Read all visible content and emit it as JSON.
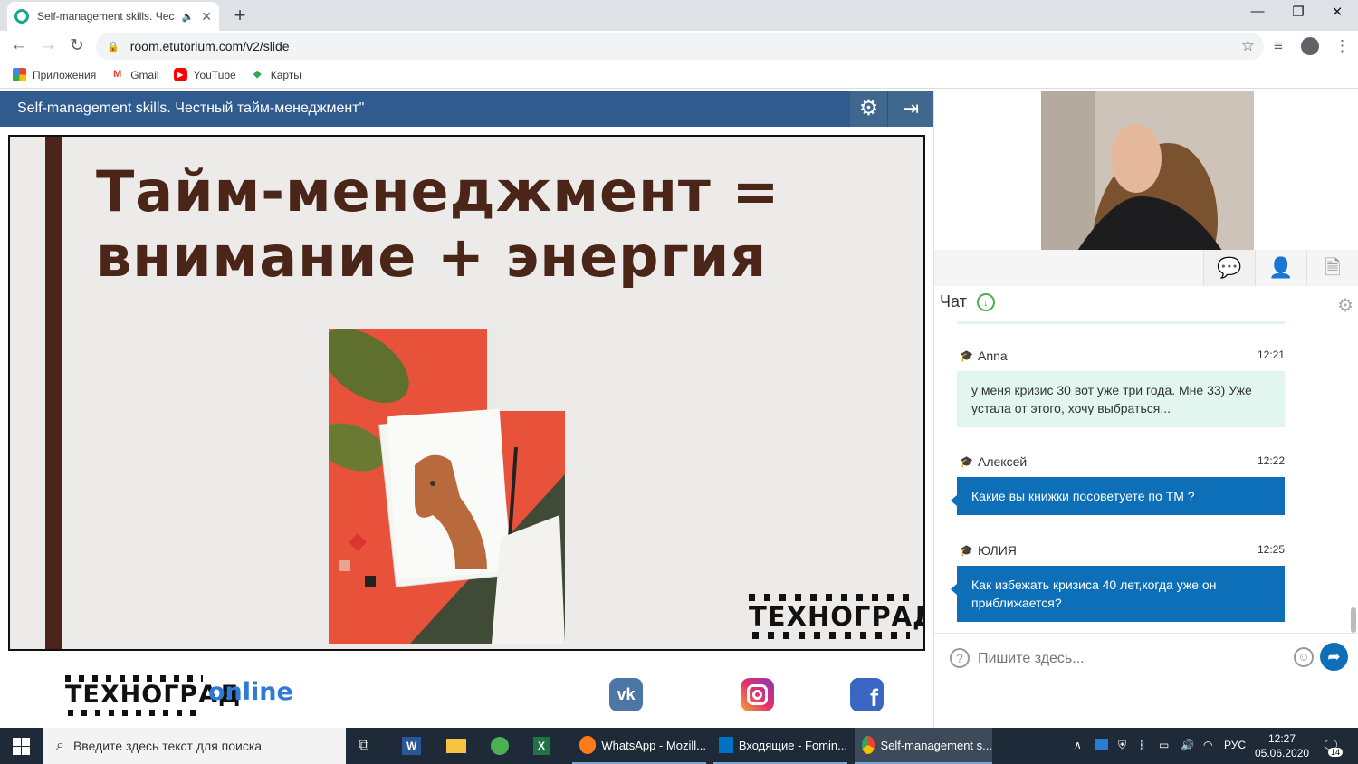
{
  "browser": {
    "tab_title": "Self-management skills. Чест",
    "url": "room.etutorium.com/v2/slide",
    "bookmarks": [
      "Приложения",
      "Gmail",
      "YouTube",
      "Карты"
    ]
  },
  "room": {
    "title": "Self-management skills. Честный тайм-менеджмент\"",
    "slide": {
      "heading_line1": "Тайм-менеджмент =",
      "heading_line2": "внимание + энергия",
      "brand": "ТЕХНОГРАД"
    },
    "footer": {
      "brand": "ТЕХНОГРАД",
      "brand_suffix": "online",
      "social": [
        "vk-icon",
        "instagram-icon",
        "facebook-icon"
      ]
    }
  },
  "chat": {
    "title": "Чат",
    "messages": [
      {
        "author": "Anna",
        "time": "12:21",
        "text": "у меня кризис 30 вот уже три года. Мне 33) Уже устала от этого, хочу выбраться...",
        "style": "green"
      },
      {
        "author": "Алексей",
        "time": "12:22",
        "text": "Какие вы книжки посоветуете по ТМ ?",
        "style": "blue"
      },
      {
        "author": "ЮЛИЯ",
        "time": "12:25",
        "text": "Как избежать кризиса 40 лет,когда уже он приближается?",
        "style": "blue"
      }
    ],
    "input_placeholder": "Пишите здесь..."
  },
  "taskbar": {
    "search_placeholder": "Введите здесь текст для поиска",
    "items": [
      "WhatsApp - Mozill...",
      "Входящие - Fomin...",
      "Self-management s..."
    ],
    "language": "РУС",
    "time": "12:27",
    "date": "05.06.2020",
    "notification_count": "14"
  },
  "colors": {
    "room_header": "#2f5b8f",
    "slide_brown": "#4a2518",
    "chat_blue": "#0d6fb8",
    "chat_green": "#e2f5ef"
  }
}
